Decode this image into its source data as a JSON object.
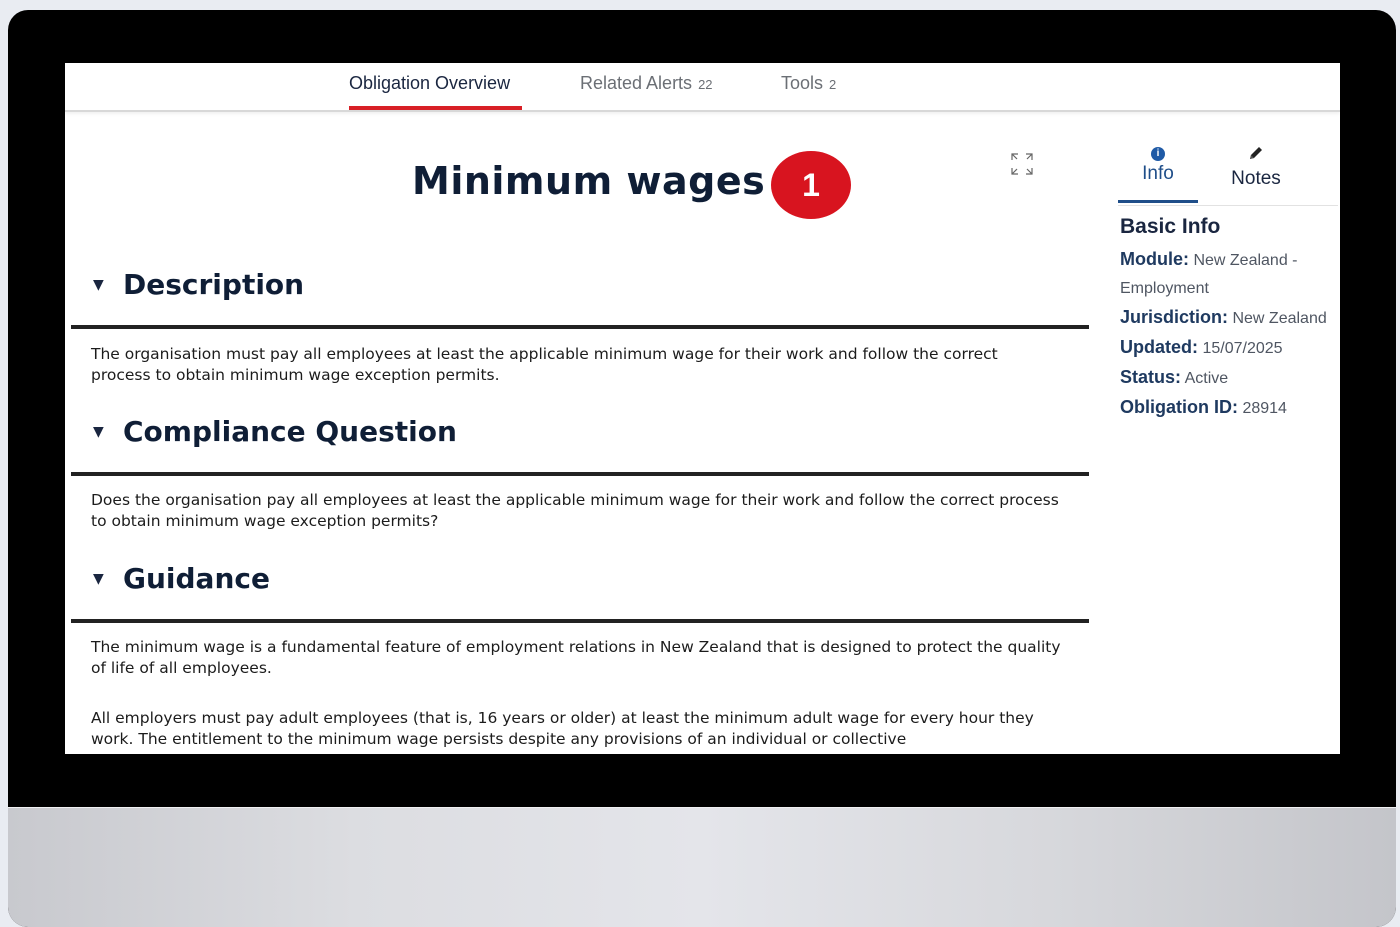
{
  "tabs": [
    {
      "label": "Obligation Overview",
      "count": ""
    },
    {
      "label": "Related Alerts",
      "count": "22"
    },
    {
      "label": "Tools",
      "count": "2"
    }
  ],
  "page_title": "Minimum wages",
  "step_badge": "1",
  "sections": {
    "description": {
      "title": "Description",
      "text": "The organisation must pay all employees at least the applicable minimum wage for their work and follow the correct process to obtain minimum wage exception permits."
    },
    "compliance": {
      "title": "Compliance Question",
      "text": "Does the organisation pay all employees at least the applicable minimum wage for their work and follow the correct process to obtain minimum wage exception permits?"
    },
    "guidance": {
      "title": "Guidance",
      "paragraphs": [
        "The minimum wage is a fundamental feature of employment relations in New Zealand that is designed to protect the quality of life of all employees.",
        "All employers must pay adult employees (that is, 16 years or older) at least the minimum adult wage for every hour they work. The entitlement to the minimum wage persists despite any provisions of an individual or collective"
      ]
    }
  },
  "side_panel": {
    "tabs": [
      {
        "label": "Info",
        "icon": "info-icon"
      },
      {
        "label": "Notes",
        "icon": "pencil-icon"
      }
    ],
    "heading": "Basic Info",
    "fields": [
      {
        "key": "Module:",
        "value": "New Zealand - Employment"
      },
      {
        "key": "Jurisdiction:",
        "value": "New Zealand"
      },
      {
        "key": "Updated:",
        "value": "15/07/2025"
      },
      {
        "key": "Status:",
        "value": "Active"
      },
      {
        "key": "Obligation ID:",
        "value": "28914"
      }
    ]
  },
  "colors": {
    "accent_red": "#d81f26",
    "badge_red": "#d8141f",
    "info_blue": "#1f4e89",
    "title_navy": "#0f1e36"
  }
}
